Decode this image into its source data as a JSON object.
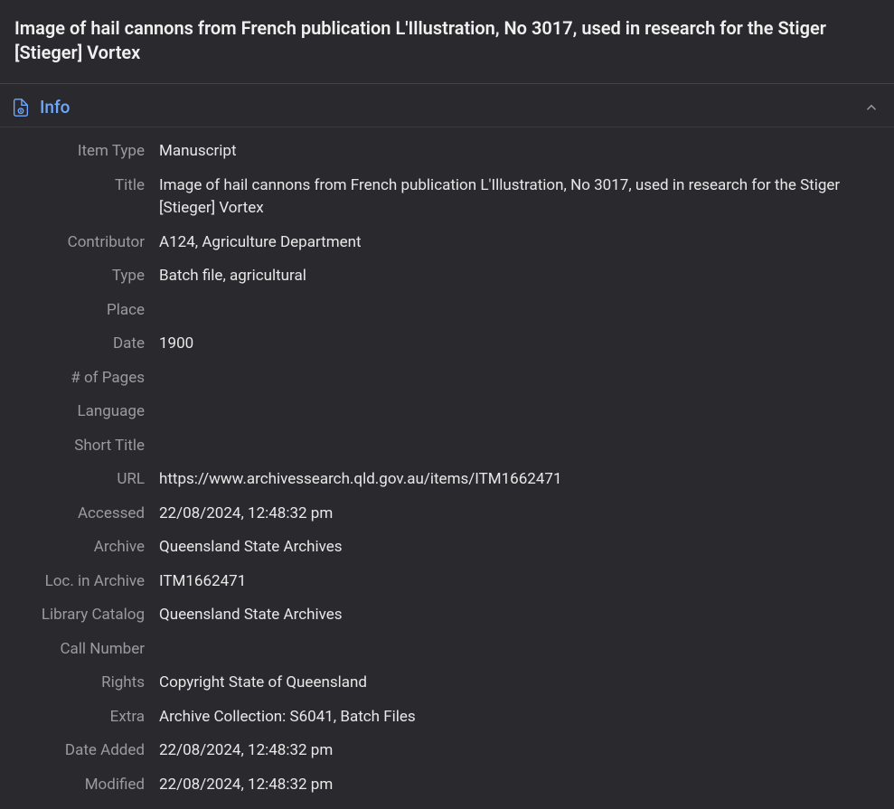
{
  "header": {
    "title": "Image of hail cannons from French publication L'Illustration, No 3017, used in research for the Stiger [Stieger] Vortex"
  },
  "section": {
    "title": "Info"
  },
  "fields": {
    "item_type": {
      "label": "Item Type",
      "value": "Manuscript"
    },
    "title": {
      "label": "Title",
      "value": "Image of hail cannons from French publication L'Illustration, No 3017, used in research for the Stiger [Stieger] Vortex"
    },
    "contributor": {
      "label": "Contributor",
      "value": "A124, Agriculture Department"
    },
    "type": {
      "label": "Type",
      "value": "Batch file, agricultural"
    },
    "place": {
      "label": "Place",
      "value": ""
    },
    "date": {
      "label": "Date",
      "value": "1900"
    },
    "num_pages": {
      "label": "# of Pages",
      "value": ""
    },
    "language": {
      "label": "Language",
      "value": ""
    },
    "short_title": {
      "label": "Short Title",
      "value": ""
    },
    "url": {
      "label": "URL",
      "value": "https://www.archivessearch.qld.gov.au/items/ITM1662471"
    },
    "accessed": {
      "label": "Accessed",
      "value": "22/08/2024, 12:48:32 pm"
    },
    "archive": {
      "label": "Archive",
      "value": "Queensland State Archives"
    },
    "loc_in_archive": {
      "label": "Loc. in Archive",
      "value": "ITM1662471"
    },
    "library_catalog": {
      "label": "Library Catalog",
      "value": "Queensland State Archives"
    },
    "call_number": {
      "label": "Call Number",
      "value": ""
    },
    "rights": {
      "label": "Rights",
      "value": "Copyright State of Queensland"
    },
    "extra": {
      "label": "Extra",
      "value": "Archive Collection: S6041, Batch Files"
    },
    "date_added": {
      "label": "Date Added",
      "value": "22/08/2024, 12:48:32 pm"
    },
    "modified": {
      "label": "Modified",
      "value": "22/08/2024, 12:48:32 pm"
    }
  }
}
